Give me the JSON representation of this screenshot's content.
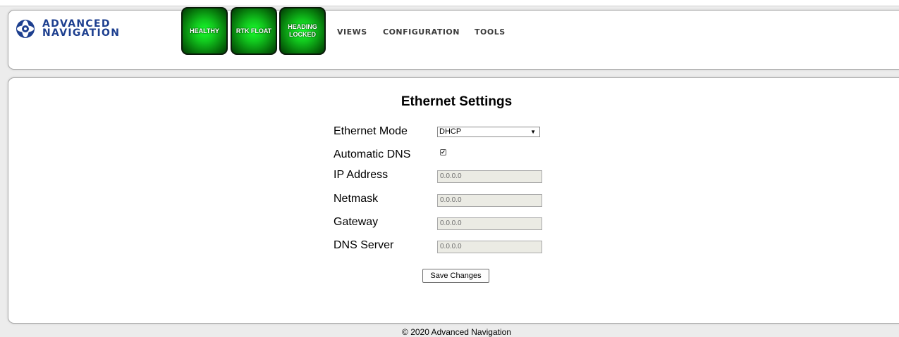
{
  "brand": {
    "line1": "ADVANCED",
    "line2": "NAVIGATION",
    "color": "#1d3f8f"
  },
  "status_indicators": [
    {
      "label": "HEALTHY",
      "color": "#11c51d"
    },
    {
      "label": "RTK FLOAT",
      "color": "#11c51d"
    },
    {
      "label_line1": "HEADING",
      "label_line2": "LOCKED",
      "color": "#11c51d"
    }
  ],
  "nav": {
    "views": "VIEWS",
    "configuration": "CONFIGURATION",
    "tools": "TOOLS"
  },
  "page": {
    "title": "Ethernet Settings"
  },
  "form": {
    "ethernet_mode": {
      "label": "Ethernet Mode",
      "value": "DHCP"
    },
    "automatic_dns": {
      "label": "Automatic DNS",
      "checked": true
    },
    "ip_address": {
      "label": "IP Address",
      "value": "0.0.0.0"
    },
    "netmask": {
      "label": "Netmask",
      "value": "0.0.0.0"
    },
    "gateway": {
      "label": "Gateway",
      "value": "0.0.0.0"
    },
    "dns_server": {
      "label": "DNS Server",
      "value": "0.0.0.0"
    },
    "save_label": "Save Changes"
  },
  "footer": {
    "copyright": "© 2020 Advanced Navigation"
  }
}
